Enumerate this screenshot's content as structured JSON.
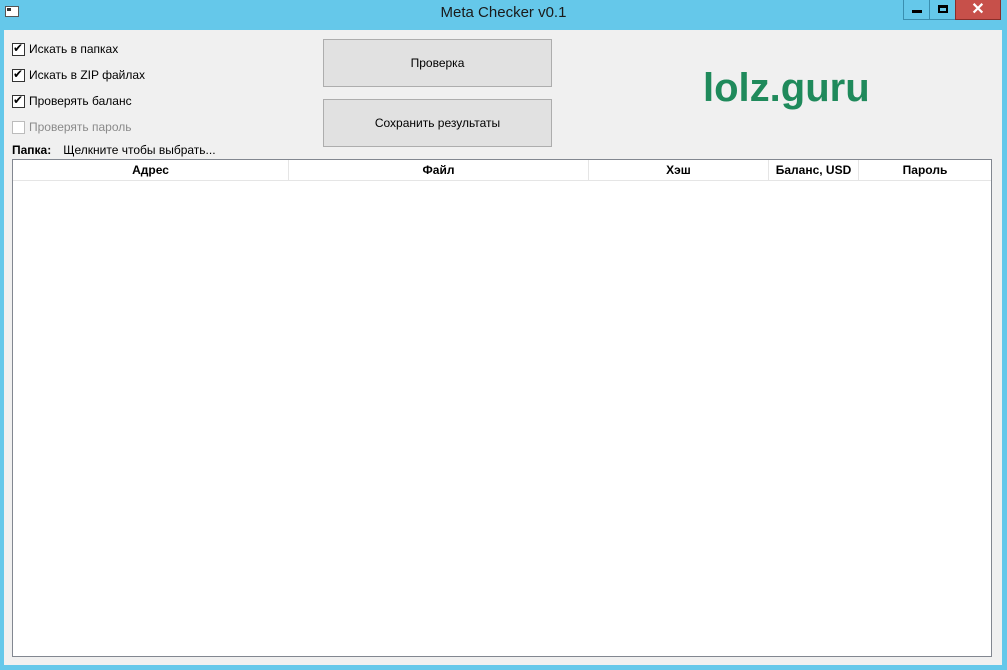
{
  "window": {
    "title": "Meta Checker v0.1",
    "close_glyph": "✕"
  },
  "options": [
    {
      "label": "Искать в папках",
      "checked": true,
      "enabled": true
    },
    {
      "label": "Искать в ZIP файлах",
      "checked": true,
      "enabled": true
    },
    {
      "label": "Проверять баланс",
      "checked": true,
      "enabled": true
    },
    {
      "label": "Проверять пароль",
      "checked": false,
      "enabled": false
    }
  ],
  "buttons": {
    "check": "Проверка",
    "save": "Сохранить результаты"
  },
  "logo": "lolz.guru",
  "folder": {
    "label": "Папка:",
    "value": "Щелкните чтобы выбрать..."
  },
  "table": {
    "columns": [
      "Адрес",
      "Файл",
      "Хэш",
      "Баланс, USD",
      "Пароль"
    ],
    "rows": []
  },
  "colors": {
    "titlebar": "#65c8ea",
    "close": "#c7504a",
    "logo": "#1f8a5b"
  }
}
